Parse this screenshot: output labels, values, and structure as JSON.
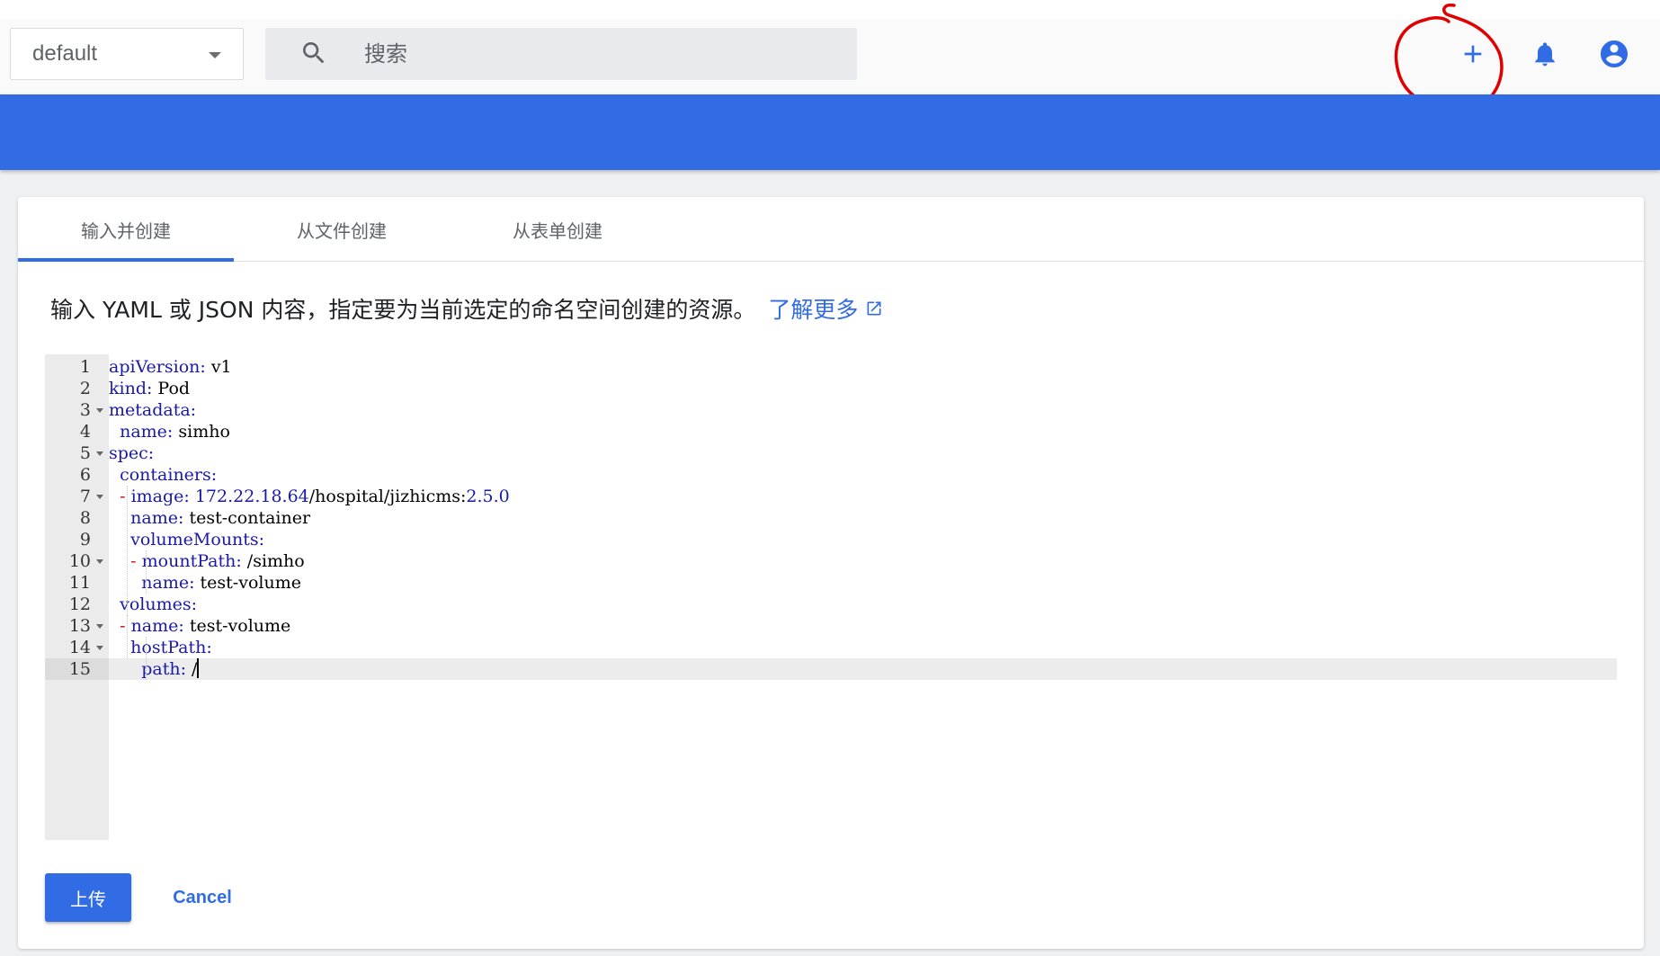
{
  "header": {
    "namespace": {
      "value": "default"
    },
    "search": {
      "placeholder": "搜索"
    },
    "actions": {
      "create_icon": "plus-icon",
      "notifications_icon": "bell-icon",
      "account_icon": "account-circle-icon"
    }
  },
  "colors": {
    "accent": "#326ce5",
    "annotation": "#e00000"
  },
  "tabs": [
    {
      "label": "输入并创建",
      "active": true
    },
    {
      "label": "从文件创建",
      "active": false
    },
    {
      "label": "从表单创建",
      "active": false
    }
  ],
  "description": {
    "text": "输入 YAML 或 JSON 内容，指定要为当前选定的命名空间创建的资源。",
    "link": "了解更多"
  },
  "editor": {
    "active_line": 15,
    "lines": [
      {
        "num": "1",
        "fold": false,
        "parts": [
          [
            "k",
            "apiVersion:"
          ],
          [
            "v",
            " v1"
          ]
        ]
      },
      {
        "num": "2",
        "fold": false,
        "parts": [
          [
            "k",
            "kind:"
          ],
          [
            "v",
            " Pod"
          ]
        ]
      },
      {
        "num": "3",
        "fold": true,
        "parts": [
          [
            "k",
            "metadata:"
          ]
        ]
      },
      {
        "num": "4",
        "fold": false,
        "parts": [
          [
            "v",
            "  "
          ],
          [
            "k",
            "name:"
          ],
          [
            "v",
            " simho"
          ]
        ]
      },
      {
        "num": "5",
        "fold": true,
        "parts": [
          [
            "k",
            "spec:"
          ]
        ]
      },
      {
        "num": "6",
        "fold": false,
        "parts": [
          [
            "v",
            "  "
          ],
          [
            "k",
            "containers:"
          ]
        ]
      },
      {
        "num": "7",
        "fold": true,
        "parts": [
          [
            "v",
            "  "
          ],
          [
            "dash",
            "-"
          ],
          [
            "v",
            " "
          ],
          [
            "k",
            "image:"
          ],
          [
            "v",
            " "
          ],
          [
            "n",
            "172.22.18.64"
          ],
          [
            "v",
            "/hospital/jizhicms:"
          ],
          [
            "n",
            "2.5.0"
          ]
        ]
      },
      {
        "num": "8",
        "fold": false,
        "parts": [
          [
            "v",
            "    "
          ],
          [
            "k",
            "name:"
          ],
          [
            "v",
            " test-container"
          ]
        ]
      },
      {
        "num": "9",
        "fold": false,
        "parts": [
          [
            "v",
            "    "
          ],
          [
            "k",
            "volumeMounts:"
          ]
        ]
      },
      {
        "num": "10",
        "fold": true,
        "parts": [
          [
            "v",
            "    "
          ],
          [
            "dash",
            "-"
          ],
          [
            "v",
            " "
          ],
          [
            "k",
            "mountPath:"
          ],
          [
            "v",
            " /simho"
          ]
        ]
      },
      {
        "num": "11",
        "fold": false,
        "parts": [
          [
            "v",
            "      "
          ],
          [
            "k",
            "name:"
          ],
          [
            "v",
            " test-volume"
          ]
        ]
      },
      {
        "num": "12",
        "fold": false,
        "parts": [
          [
            "v",
            "  "
          ],
          [
            "k",
            "volumes:"
          ]
        ]
      },
      {
        "num": "13",
        "fold": true,
        "parts": [
          [
            "v",
            "  "
          ],
          [
            "dash",
            "-"
          ],
          [
            "v",
            " "
          ],
          [
            "k",
            "name:"
          ],
          [
            "v",
            " test-volume"
          ]
        ]
      },
      {
        "num": "14",
        "fold": true,
        "parts": [
          [
            "v",
            "    "
          ],
          [
            "k",
            "hostPath:"
          ]
        ]
      },
      {
        "num": "15",
        "fold": false,
        "parts": [
          [
            "v",
            "      "
          ],
          [
            "k",
            "path:"
          ],
          [
            "v",
            " /"
          ]
        ]
      }
    ]
  },
  "footer": {
    "upload_label": "上传",
    "cancel_label": "Cancel"
  }
}
